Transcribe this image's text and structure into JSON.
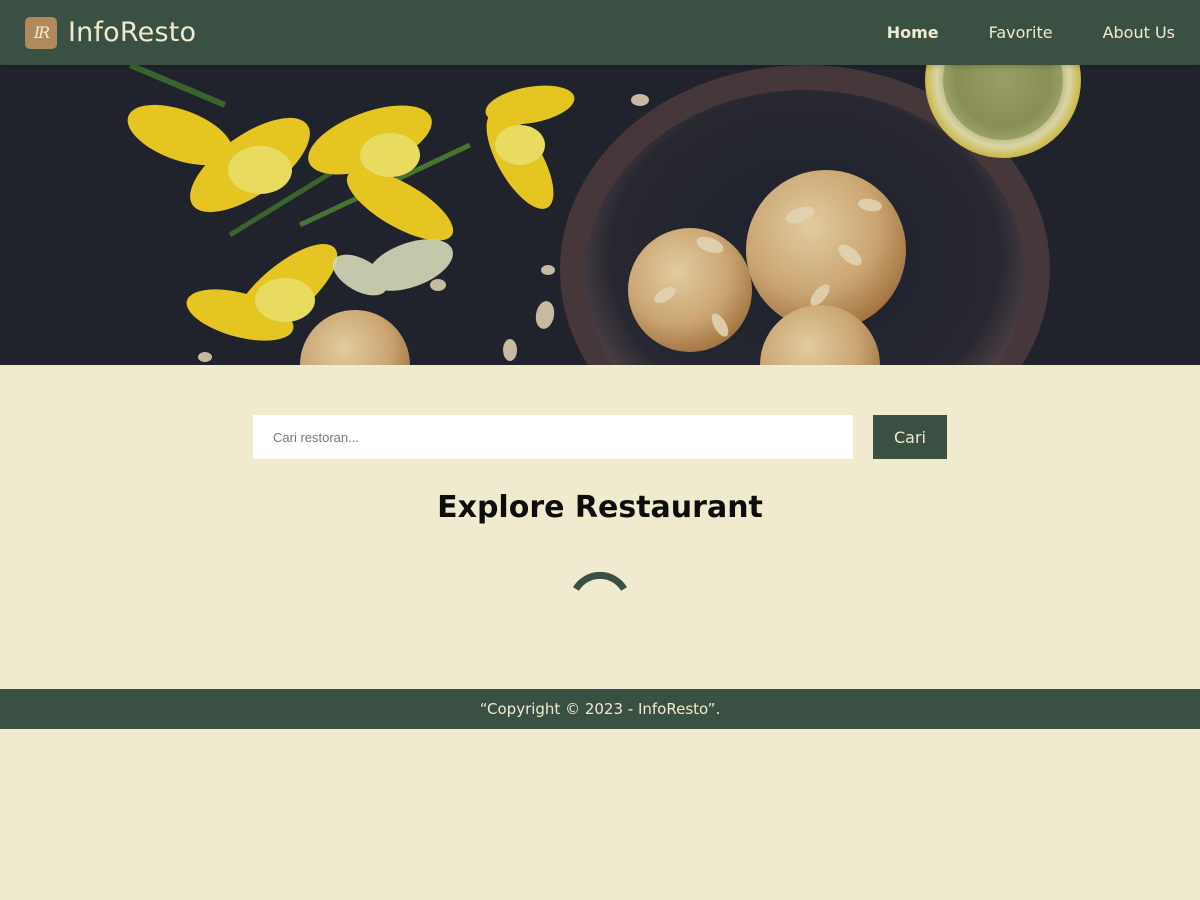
{
  "header": {
    "logo_text": "IR",
    "brand": "InfoResto",
    "nav": [
      {
        "label": "Home"
      },
      {
        "label": "Favorite"
      },
      {
        "label": "About Us"
      }
    ]
  },
  "hero": {
    "image": "food-hero-image"
  },
  "search": {
    "placeholder": "Cari restoran...",
    "value": "",
    "button_label": "Cari"
  },
  "main": {
    "title": "Explore Restaurant",
    "loading_icon": "spinner-icon"
  },
  "footer": {
    "text": "“Copyright © 2023 - InfoResto”."
  },
  "colors": {
    "primary": "#3a5043",
    "background": "#f0ebcf",
    "logo": "#b08a5a"
  }
}
